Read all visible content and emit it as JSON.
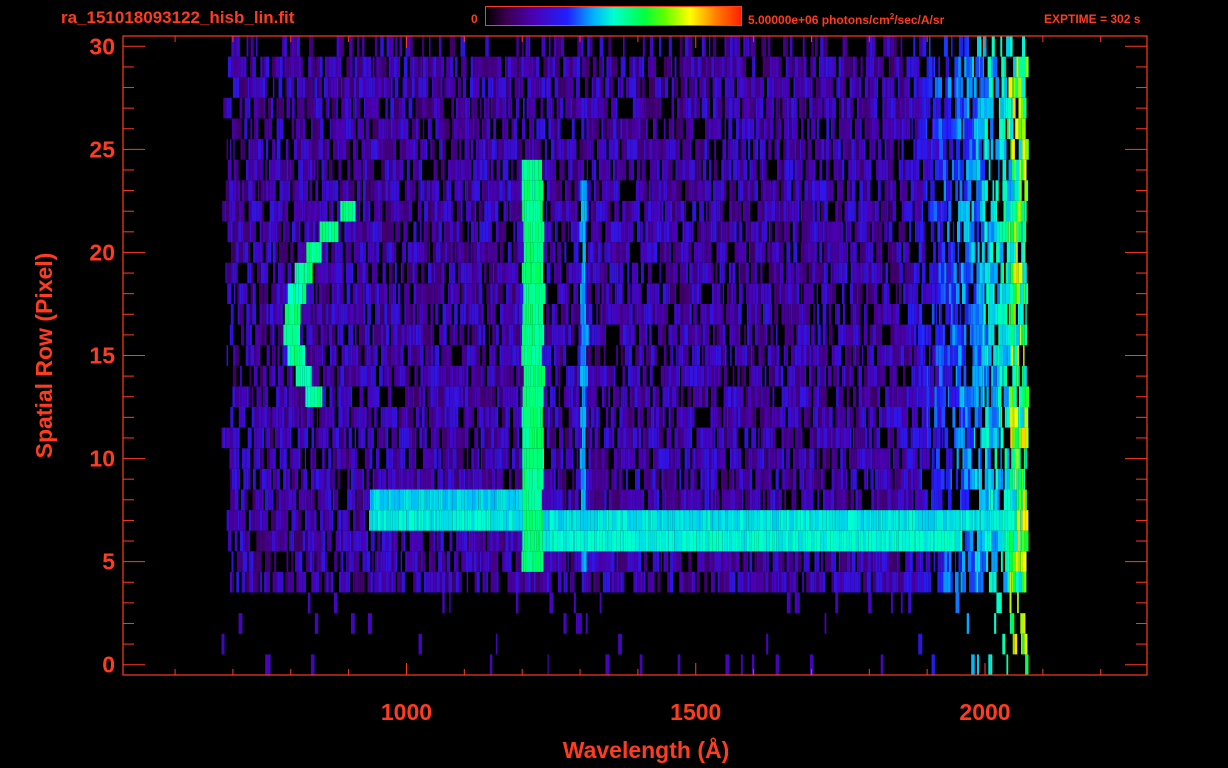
{
  "header": {
    "file_title": "ra_151018093122_hisb_lin.fit",
    "colorbar_min": "0",
    "colorbar_max_prefix": "5.00000e+06 photons/cm",
    "colorbar_max_sup": "2",
    "colorbar_max_suffix": "/sec/A/sr",
    "exptime": "EXPTIME = 302 s"
  },
  "colors": {
    "axis": "#ff3b20",
    "background": "#000000"
  },
  "chart_data": {
    "type": "heatmap",
    "title": "ra_151018093122_hisb_lin.fit",
    "xlabel": "Wavelength (Å)",
    "ylabel": "Spatial Row (Pixel)",
    "xlim": [
      510,
      2280
    ],
    "ylim": [
      -0.5,
      30.5
    ],
    "x_ticks": [
      1000,
      1500,
      2000
    ],
    "y_ticks": [
      0,
      5,
      10,
      15,
      20,
      25,
      30
    ],
    "colorbar": {
      "min": 0,
      "max": 5000000,
      "units": "photons/cm^2/sec/A/sr"
    },
    "features": [
      {
        "name": "Lyman-alpha line",
        "x": 1216,
        "rows": [
          5,
          24
        ]
      },
      {
        "name": "emission line",
        "x": 1304,
        "rows": [
          5,
          23
        ]
      },
      {
        "name": "continuum band",
        "x_range": [
          930,
          2070
        ],
        "rows": [
          6,
          8
        ]
      },
      {
        "name": "arc",
        "x_range": [
          790,
          900
        ],
        "rows": [
          13,
          22
        ]
      }
    ]
  }
}
